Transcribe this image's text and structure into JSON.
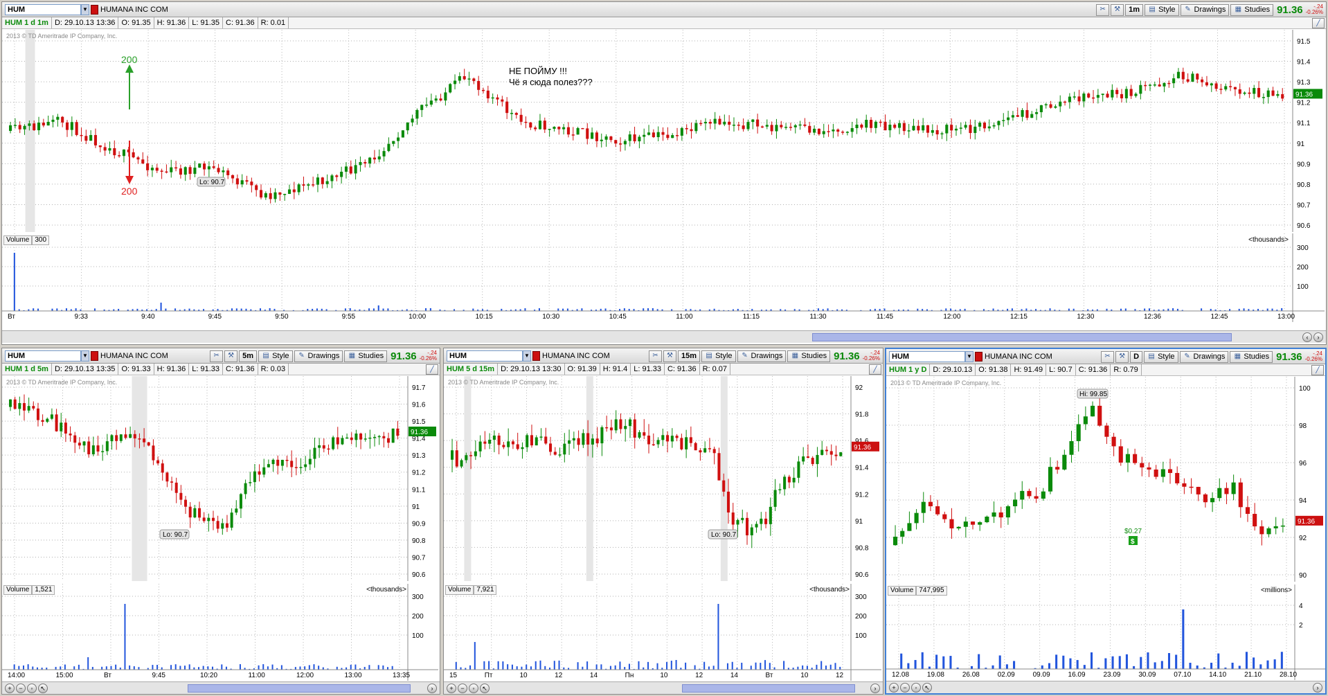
{
  "common": {
    "symbol": "HUM",
    "company": "HUMANA INC COM",
    "price": "91.36",
    "change": "-.24",
    "change_pct": "-0.26%",
    "style_label": "Style",
    "drawings_label": "Drawings",
    "studies_label": "Studies",
    "copyright": "2013 © TD Ameritrade IP Company, Inc.",
    "colors": {
      "up": "#0a8a0a",
      "down": "#d01010",
      "volume": "#2255dd",
      "price_tag_green": "#0a8a0a",
      "price_tag_red": "#cc1010"
    }
  },
  "main": {
    "period_label": "1m",
    "info": {
      "desc": "HUM 1 d 1m",
      "date": "D: 29.10.13 13:36",
      "open": "O: 91.35",
      "high": "H: 91.36",
      "low": "L: 91.35",
      "close": "C: 91.36",
      "range": "R: 0.01"
    },
    "price_axis": [
      "91.5",
      "91.4",
      "91.3",
      "91.2",
      "91.1",
      "91",
      "90.9",
      "90.8",
      "90.7",
      "90.6"
    ],
    "lo_label": "Lo: 90.7",
    "annotation_line1": "НЕ ПОЙМУ !!!",
    "annotation_line2": "Чё я сюда полез???",
    "arrow_up_label": "200",
    "arrow_down_label": "200",
    "volume_label": "Volume",
    "volume_value": "300",
    "volume_unit": "<thousands>",
    "volume_axis": [
      "300",
      "200",
      "100"
    ],
    "time_axis": [
      "Вт",
      "9:33",
      "9:40",
      "9:45",
      "9:50",
      "9:55",
      "10:00",
      "10:15",
      "10:30",
      "10:45",
      "11:00",
      "11:15",
      "11:30",
      "11:45",
      "12:00",
      "12:15",
      "12:30",
      "12:36",
      "12:45",
      "13:00"
    ]
  },
  "p5m": {
    "period_label": "5m",
    "info": {
      "desc": "HUM 1 d 5m",
      "date": "D: 29.10.13 13:35",
      "open": "O: 91.33",
      "high": "H: 91.36",
      "low": "L: 91.33",
      "close": "C: 91.36",
      "range": "R: 0.03"
    },
    "price_axis": [
      "91.7",
      "91.6",
      "91.5",
      "91.4",
      "91.3",
      "91.2",
      "91.1",
      "91",
      "90.9",
      "90.8",
      "90.7",
      "90.6"
    ],
    "lo_label": "Lo: 90.7",
    "volume_label": "Volume",
    "volume_value": "1,521",
    "volume_unit": "<thousands>",
    "volume_axis": [
      "300",
      "200",
      "100"
    ],
    "time_axis": [
      "14:00",
      "15:00",
      "Вт",
      "9:45",
      "10:20",
      "11:00",
      "12:00",
      "13:00",
      "13:35"
    ]
  },
  "p15m": {
    "period_label": "15m",
    "info": {
      "desc": "HUM 5 d 15m",
      "date": "D: 29.10.13 13:30",
      "open": "O: 91.39",
      "high": "H: 91.4",
      "low": "L: 91.33",
      "close": "C: 91.36",
      "range": "R: 0.07"
    },
    "price_axis": [
      "92",
      "91.8",
      "91.6",
      "91.4",
      "91.2",
      "91",
      "90.8",
      "90.6"
    ],
    "lo_label": "Lo: 90.7",
    "volume_label": "Volume",
    "volume_value": "7,921",
    "volume_unit": "<thousands>",
    "volume_axis": [
      "300",
      "200",
      "100"
    ],
    "time_axis": [
      "15",
      "Пт",
      "10",
      "12",
      "14",
      "Пн",
      "10",
      "12",
      "14",
      "Вт",
      "10",
      "12"
    ]
  },
  "pday": {
    "period_label": "D",
    "info": {
      "desc": "HUM 1 y D",
      "date": "D: 29.10.13",
      "open": "O: 91.38",
      "high": "H: 91.49",
      "low": "L: 90.7",
      "close": "C: 91.36",
      "range": "R: 0.79"
    },
    "price_axis": [
      "100",
      "98",
      "96",
      "94",
      "92",
      "90"
    ],
    "hi_label": "Hi: 99.85",
    "dividend_label": "$0.27",
    "dividend_icon": "$",
    "volume_label": "Volume",
    "volume_value": "747,995",
    "volume_unit": "<millions>",
    "volume_axis": [
      "4",
      "2"
    ],
    "time_axis": [
      "12.08",
      "19.08",
      "26.08",
      "02.09",
      "09.09",
      "16.09",
      "23.09",
      "30.09",
      "07.10",
      "14.10",
      "21.10",
      "28.10"
    ]
  }
}
